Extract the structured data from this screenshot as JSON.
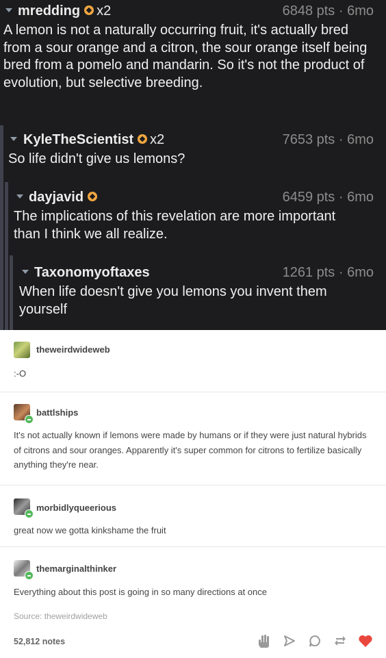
{
  "reddit": {
    "comments": [
      {
        "user": "mredding",
        "multiplier": "x2",
        "meta": "6848 pts · 6mo",
        "body": "A lemon is not a naturally occurring fruit, it's actually bred from a sour orange and a citron, the sour orange itself being bred from a pomelo and mandarin. So it's not the product of evolution, but selective breeding."
      },
      {
        "user": "KyleTheScientist",
        "multiplier": "x2",
        "meta": "7653 pts · 6mo",
        "body": "So life didn't give us lemons?"
      },
      {
        "user": "dayjavid",
        "multiplier": "",
        "meta": "6459 pts · 6mo",
        "body": "The implications of this revelation are more important than I think we all realize."
      },
      {
        "user": "Taxonomyoftaxes",
        "multiplier": "",
        "meta": "1261 pts · 6mo",
        "body": "When life doesn't give you lemons you invent them yourself"
      }
    ],
    "colors": {
      "background": "#1c1c1e",
      "badge": "#f1a640",
      "thread_bar": "#40434d"
    }
  },
  "tumblr": {
    "posts": [
      {
        "user": "theweirdwideweb",
        "text": ":-O"
      },
      {
        "user": "battlships",
        "text": "It's not actually known if lemons were made by humans or if they were just natural hybrids of citrons and sour oranges. Apparently it's super common for citrons to fertilize basically anything they're near."
      },
      {
        "user": "morbidlyqueerious",
        "text": "great now we gotta kinkshame the fruit"
      },
      {
        "user": "themarginalthinker",
        "text": "Everything about this post is going in so many directions at once"
      }
    ],
    "source": "Source: theweirdwideweb",
    "notes": "52,812 notes",
    "actions": [
      "hand-icon",
      "send-icon",
      "comment-icon",
      "reblog-icon",
      "heart-icon"
    ],
    "colors": {
      "heart": "#e9473d",
      "follow_badge": "#54b95c"
    }
  }
}
